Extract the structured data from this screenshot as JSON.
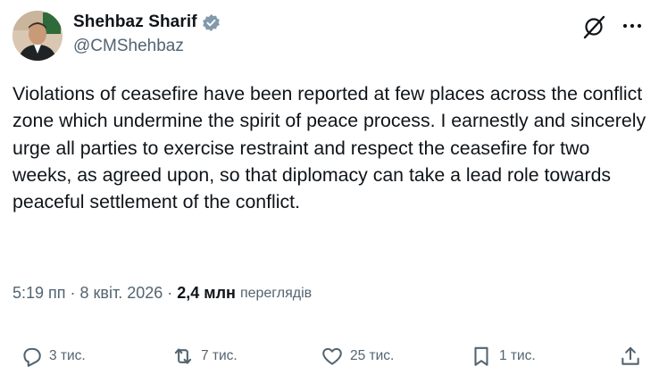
{
  "author": {
    "display_name": "Shehbaz Sharif",
    "handle": "@CMShehbaz"
  },
  "tweet": {
    "text": "Violations of ceasefire have been reported at few places across the conflict zone which undermine the spirit of peace process. I earnestly and sincerely urge all parties to exercise restraint and respect the ceasefire for two weeks, as agreed upon, so that diplomacy can take a lead role towards peaceful settlement of the conflict."
  },
  "meta": {
    "time": "5:19 пп",
    "separator": "·",
    "date": "8 квіт. 2026",
    "views_count": "2,4 млн",
    "views_label": "переглядів"
  },
  "actions": {
    "replies": "3 тис.",
    "reposts": "7 тис.",
    "likes": "25 тис.",
    "bookmarks": "1 тис."
  },
  "colors": {
    "text": "#0f1419",
    "secondary": "#536471",
    "verified_badge": "#829aab"
  }
}
